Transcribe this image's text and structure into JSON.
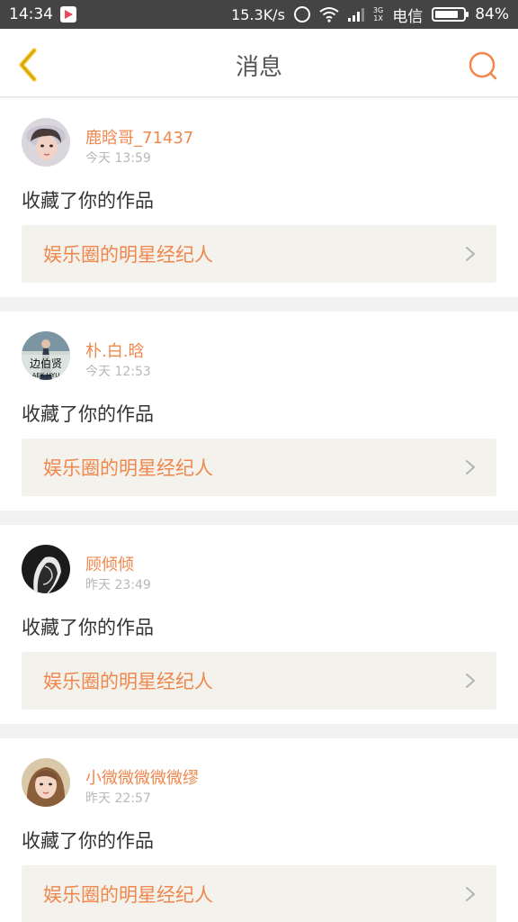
{
  "status_bar": {
    "time": "14:34",
    "net_speed": "15.3K/s",
    "network_3g": "3G",
    "network_1x": "1X",
    "carrier": "电信",
    "battery": "84%",
    "battery_level": 0.84
  },
  "header": {
    "title": "消息",
    "back_icon": "chevron-left-icon",
    "search_icon": "search-icon",
    "accent_color": "#f0874d",
    "back_color": "#f5c21d"
  },
  "messages": [
    {
      "username": "鹿晗哥_71437",
      "time": "今天 13:59",
      "action": "收藏了你的作品",
      "work_title": "娱乐圈的明星经纪人"
    },
    {
      "username": "朴.白.晗",
      "time": "今天 12:53",
      "action": "收藏了你的作品",
      "work_title": "娱乐圈的明星经纪人",
      "avatar_text": "边伯贤",
      "avatar_subtext": "AEK HYU"
    },
    {
      "username": "顾倾倾",
      "time": "昨天 23:49",
      "action": "收藏了你的作品",
      "work_title": "娱乐圈的明星经纪人"
    },
    {
      "username": "小微微微微微缪",
      "time": "昨天 22:57",
      "action": "收藏了你的作品",
      "work_title": "娱乐圈的明星经纪人"
    }
  ]
}
